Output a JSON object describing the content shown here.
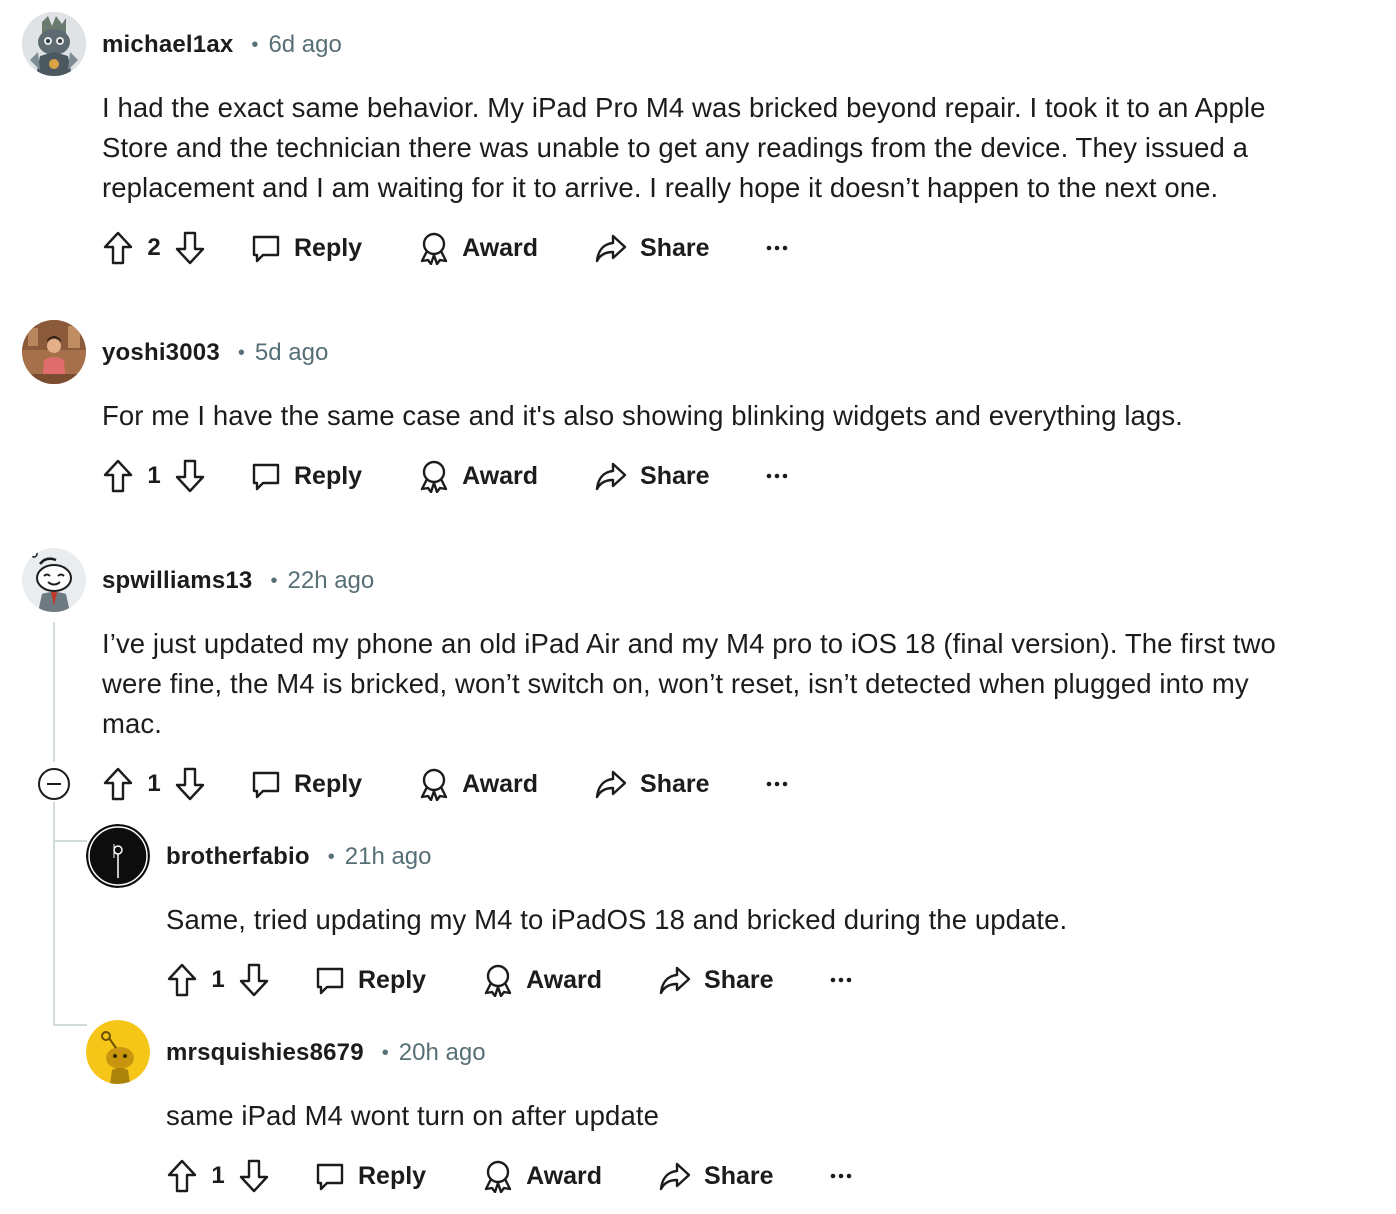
{
  "comments": [
    {
      "username": "michael1ax",
      "dot": "•",
      "time": "6d ago",
      "body_lines": [
        "I had the exact same behavior. My iPad Pro M4 was bricked beyond repair. I took it to an Apple",
        "Store and the technician there was unable to get any readings from the device. They issued a",
        "replacement and I am waiting for it to arrive. I really hope it doesn’t happen to the next one."
      ],
      "score": "2",
      "reply": "Reply",
      "award": "Award",
      "share": "Share",
      "avatar_icon": "robot-avatar-icon"
    },
    {
      "username": "yoshi3003",
      "dot": "•",
      "time": "5d ago",
      "body_lines": [
        "For me I have the same case and it's also showing blinking widgets and everything lags."
      ],
      "score": "1",
      "reply": "Reply",
      "award": "Award",
      "share": "Share",
      "avatar_icon": "photo-avatar-icon"
    },
    {
      "username": "spwilliams13",
      "dot": "•",
      "time": "22h ago",
      "body_lines": [
        "I’ve just updated my phone an old iPad Air and my M4 pro to iOS 18 (final version). The first two",
        "were fine, the M4 is bricked, won’t switch on, won’t reset, isn’t detected when plugged into my",
        "mac."
      ],
      "score": "1",
      "reply": "Reply",
      "award": "Award",
      "share": "Share",
      "avatar_icon": "snoo-avatar-icon"
    },
    {
      "username": "brotherfabio",
      "dot": "•",
      "time": "21h ago",
      "body_lines": [
        "Same, tried updating my M4 to iPadOS 18 and bricked during the update."
      ],
      "score": "1",
      "reply": "Reply",
      "award": "Award",
      "share": "Share",
      "avatar_icon": "dark-logo-avatar-icon"
    },
    {
      "username": "mrsquishies8679",
      "dot": "•",
      "time": "20h ago",
      "body_lines": [
        "same iPad M4 wont turn on after update"
      ],
      "score": "1",
      "reply": "Reply",
      "award": "Award",
      "share": "Share",
      "avatar_icon": "yellow-snoo-avatar-icon"
    }
  ],
  "colors": {
    "text": "#1c1c1c",
    "muted": "#576f76",
    "thread_line": "#d3dade",
    "snoo_yellow": "#f5c518"
  }
}
